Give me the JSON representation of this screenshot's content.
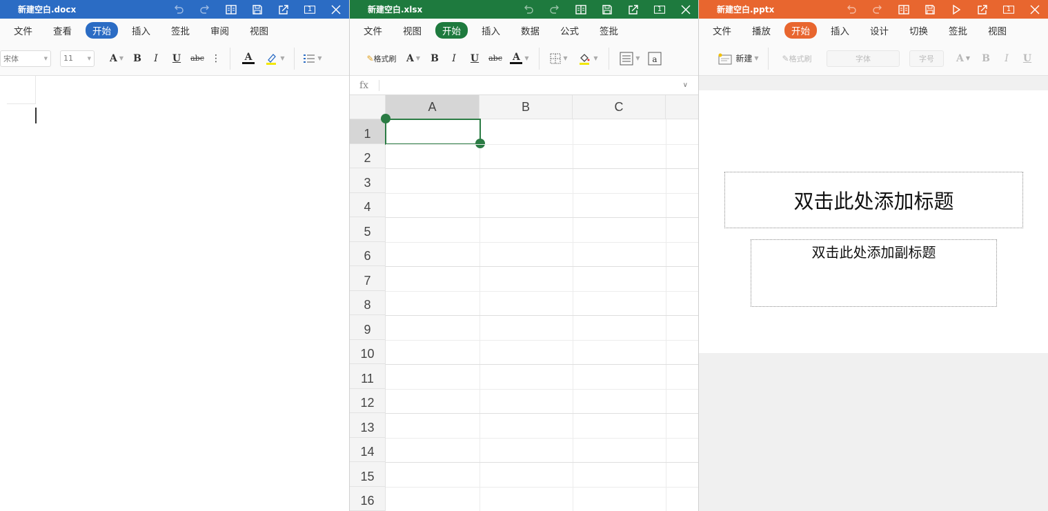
{
  "doc": {
    "title": "新建空白.docx",
    "menu": [
      "文件",
      "查看",
      "开始",
      "插入",
      "签批",
      "审阅",
      "视图"
    ],
    "active_menu": "开始",
    "font_name": "宋体",
    "font_size": "11",
    "tools": {
      "font_size_glyph": "A",
      "bold": "B",
      "italic": "I",
      "underline": "U",
      "strike": "abc",
      "more": "⋮",
      "font_color": "A"
    },
    "accent_color": "#2b6cc4"
  },
  "xls": {
    "title": "新建空白.xlsx",
    "menu": [
      "文件",
      "视图",
      "开始",
      "插入",
      "数据",
      "公式",
      "签批"
    ],
    "active_menu": "开始",
    "format_painter": "格式刷",
    "tools": {
      "font_size_glyph": "A",
      "bold": "B",
      "italic": "I",
      "underline": "U",
      "strike": "abc",
      "font_color": "A"
    },
    "fx_label": "fx",
    "columns": [
      "A",
      "B",
      "C"
    ],
    "rows": [
      "1",
      "2",
      "3",
      "4",
      "5",
      "6",
      "7",
      "8",
      "9",
      "10",
      "11",
      "12",
      "13",
      "14",
      "15",
      "16"
    ],
    "selected_cell": "A1",
    "accent_color": "#1e7a3e"
  },
  "ppt": {
    "title": "新建空白.pptx",
    "menu": [
      "文件",
      "播放",
      "开始",
      "插入",
      "设计",
      "切换",
      "签批",
      "视图"
    ],
    "active_menu": "开始",
    "new_label": "新建",
    "format_painter": "格式刷",
    "font_name_placeholder": "字体",
    "font_size_placeholder": "字号",
    "tools": {
      "font_size_glyph": "A",
      "bold": "B",
      "italic": "I",
      "underline": "U"
    },
    "title_placeholder": "双击此处添加标题",
    "subtitle_placeholder": "双击此处添加副标题",
    "accent_color": "#e8662f"
  },
  "titlebar_icons": {
    "doc": [
      "undo-icon",
      "redo-icon",
      "read-mode-icon",
      "save-icon",
      "share-icon",
      "page-count-icon",
      "close-icon"
    ],
    "xls": [
      "undo-icon",
      "redo-icon",
      "read-mode-icon",
      "save-icon",
      "share-icon",
      "page-count-icon",
      "close-icon"
    ],
    "ppt": [
      "undo-icon",
      "redo-icon",
      "read-mode-icon",
      "save-icon",
      "play-icon",
      "share-icon",
      "page-count-icon",
      "close-icon"
    ]
  },
  "page_count": "1"
}
